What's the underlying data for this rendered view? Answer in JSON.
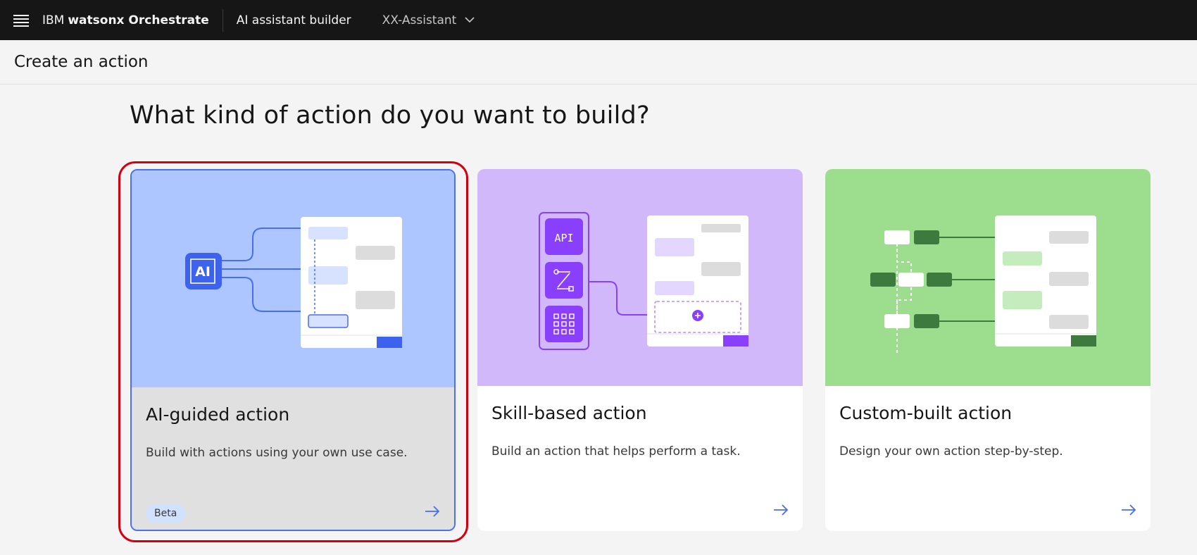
{
  "topbar": {
    "brand_prefix": "IBM",
    "brand_name": "watsonx Orchestrate",
    "nav_title": "AI assistant builder",
    "assistant_name": "XX-Assistant"
  },
  "page": {
    "header": "Create an action",
    "question": "What kind of action do you want to build?"
  },
  "cards": [
    {
      "title": "AI-guided action",
      "description": "Build with actions using your own use case.",
      "badge": "Beta",
      "illustration_label": "AI",
      "accent": "#4a6df0",
      "selected": true
    },
    {
      "title": "Skill-based action",
      "description": "Build an action that helps perform a task.",
      "illustration_label": "API",
      "accent": "#8a3ffc"
    },
    {
      "title": "Custom-built action",
      "description": "Design your own action step-by-step.",
      "accent": "#3d7a3d"
    }
  ],
  "colors": {
    "topbar_bg": "#161616",
    "page_bg": "#f4f4f4",
    "ai_card_bg": "#adc6ff",
    "skill_card_bg": "#d0b8fa",
    "custom_card_bg": "#9ddd8e",
    "arrow": "#4a6df0",
    "highlight_outline": "#d4000f"
  }
}
